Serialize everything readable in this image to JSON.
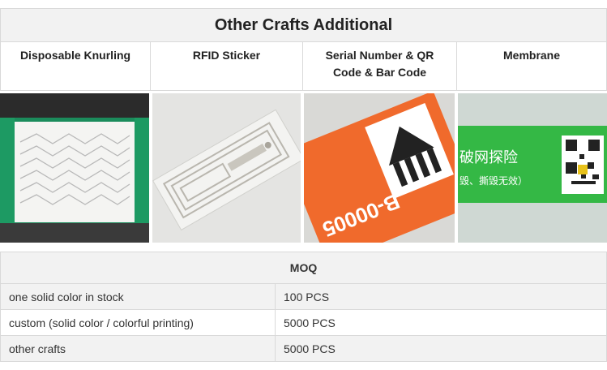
{
  "crafts": {
    "title": "Other Crafts Additional",
    "columns": [
      "Disposable Knurling",
      "RFID Sticker",
      "Serial Number & QR Code & Bar Code",
      "Membrane"
    ],
    "photo_texts": {
      "serial_label": "B-00005",
      "membrane_text_1": "破网探险",
      "membrane_text_2": "毁、撕毁无效）"
    }
  },
  "moq": {
    "title": "MOQ",
    "rows": [
      {
        "item": "one solid color in stock",
        "qty": "100 PCS"
      },
      {
        "item": "custom (solid color / colorful printing)",
        "qty": "5000 PCS"
      },
      {
        "item": "other crafts",
        "qty": "5000 PCS"
      }
    ]
  },
  "colors": {
    "border": "#d9d9d9",
    "header_bg": "#f2f2f2",
    "wristband_green": "#1a8a5a",
    "serial_orange": "#f06a2c",
    "membrane_green": "#2fb43e"
  }
}
